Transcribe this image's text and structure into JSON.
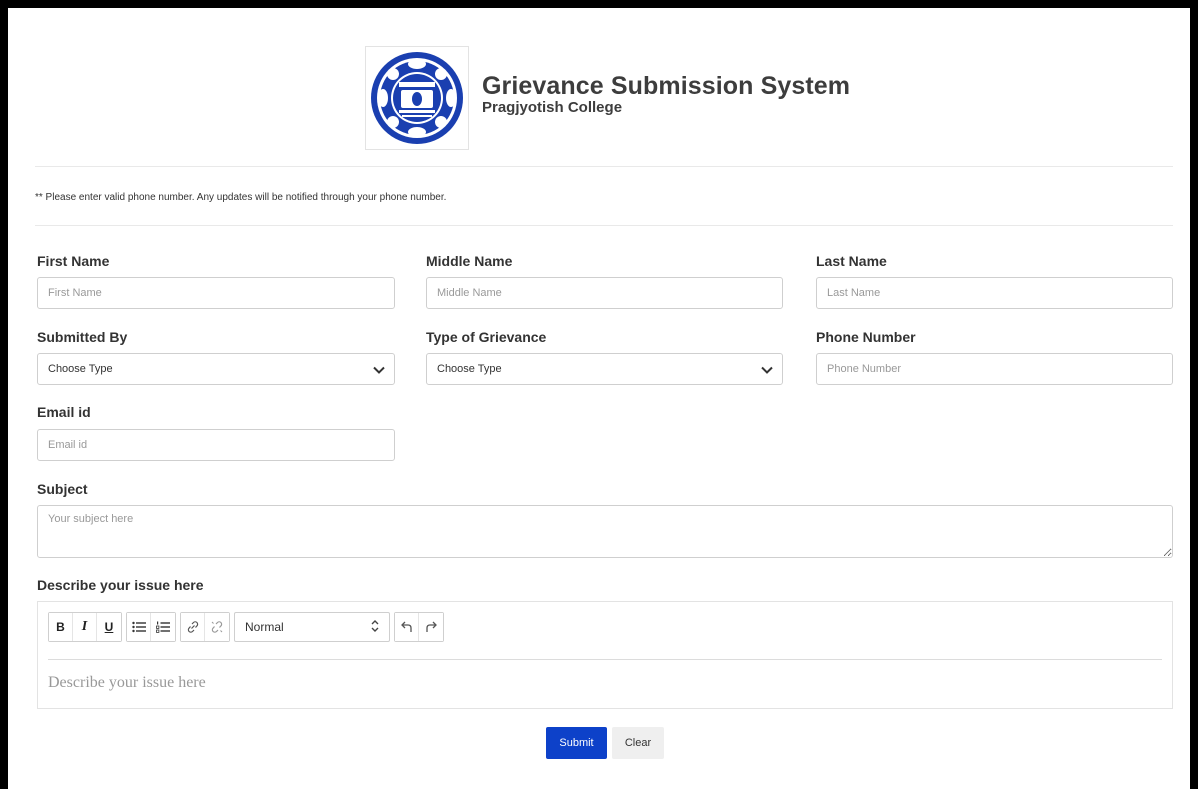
{
  "header": {
    "title": "Grievance Submission System",
    "subtitle": "Pragjyotish College",
    "logo_icon": "college-seal-logo"
  },
  "note": "** Please enter valid phone number. Any updates will be notified through your phone number.",
  "form": {
    "first_name": {
      "label": "First Name",
      "placeholder": "First Name",
      "value": ""
    },
    "middle_name": {
      "label": "Middle Name",
      "placeholder": "Middle Name",
      "value": ""
    },
    "last_name": {
      "label": "Last Name",
      "placeholder": "Last Name",
      "value": ""
    },
    "submitted_by": {
      "label": "Submitted By",
      "selected": "Choose Type"
    },
    "type_of_grievance": {
      "label": "Type of Grievance",
      "selected": "Choose Type"
    },
    "phone_number": {
      "label": "Phone Number",
      "placeholder": "Phone Number",
      "value": ""
    },
    "email": {
      "label": "Email id",
      "placeholder": "Email id",
      "value": ""
    },
    "subject": {
      "label": "Subject",
      "placeholder": "Your subject here",
      "value": ""
    },
    "description": {
      "label": "Describe your issue here",
      "placeholder": "Describe your issue here",
      "format_selected": "Normal",
      "toolbar": {
        "bold": "B",
        "italic": "I",
        "underline": "U"
      }
    }
  },
  "actions": {
    "submit_label": "Submit",
    "clear_label": "Clear"
  },
  "colors": {
    "primary": "#0d41c9",
    "logo_blue": "#1a3fb0",
    "border": "#cfcfcf"
  }
}
